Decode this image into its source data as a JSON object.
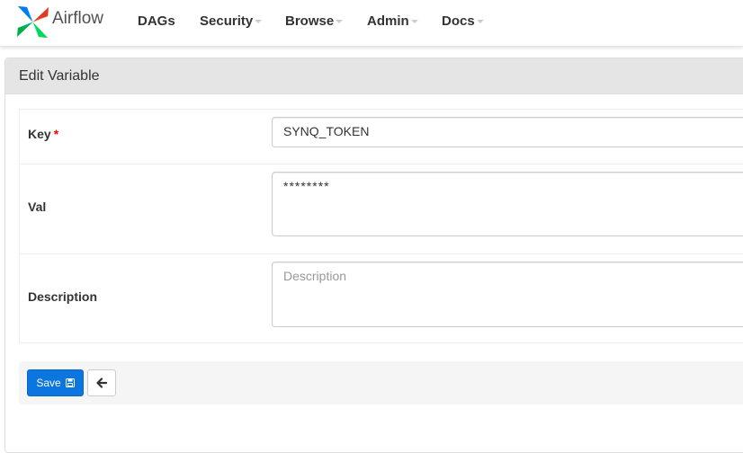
{
  "app": {
    "brand_name": "Airflow",
    "logo_colors": [
      "#017cee",
      "#00ad46",
      "#e43921",
      "#04d659"
    ]
  },
  "navbar": {
    "items": [
      {
        "label": "DAGs",
        "has_caret": false
      },
      {
        "label": "Security",
        "has_caret": true
      },
      {
        "label": "Browse",
        "has_caret": true
      },
      {
        "label": "Admin",
        "has_caret": true
      },
      {
        "label": "Docs",
        "has_caret": true
      }
    ]
  },
  "panel": {
    "title": "Edit Variable"
  },
  "form": {
    "key": {
      "label": "Key",
      "required_marker": "*",
      "value": "SYNQ_TOKEN"
    },
    "val": {
      "label": "Val",
      "value": "********"
    },
    "description": {
      "label": "Description",
      "value": "",
      "placeholder": "Description"
    }
  },
  "actions": {
    "save_label": "Save",
    "save_icon": "save-icon",
    "back_icon": "arrow-left-icon",
    "primary_color": "#0c76e0"
  }
}
